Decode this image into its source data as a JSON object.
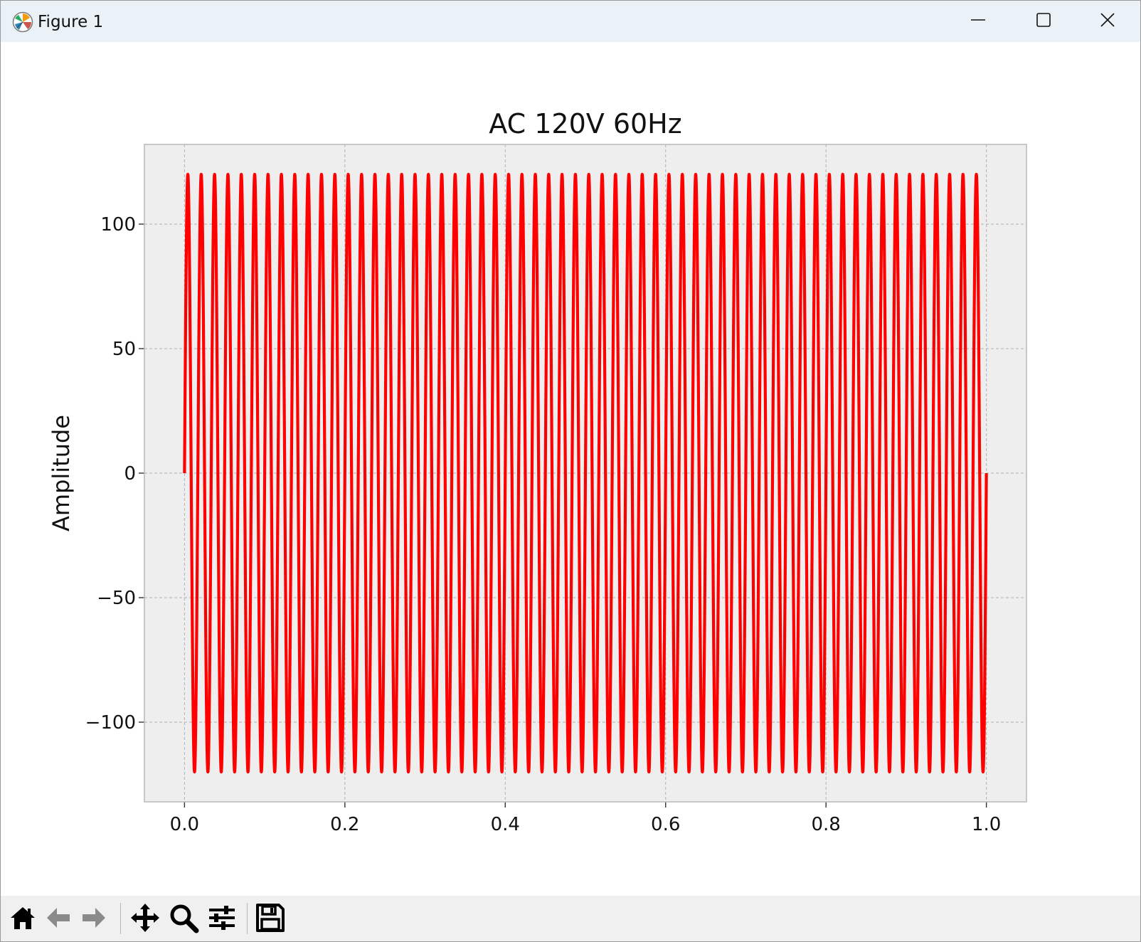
{
  "window": {
    "title": "Figure 1",
    "app_icon": "matplotlib-icon"
  },
  "window_controls": [
    {
      "name": "minimize-button",
      "icon": "minimize-icon"
    },
    {
      "name": "maximize-button",
      "icon": "maximize-icon"
    },
    {
      "name": "close-button",
      "icon": "close-icon"
    }
  ],
  "toolbar": {
    "tools": [
      {
        "name": "home-button",
        "icon": "home-icon"
      },
      {
        "name": "back-button",
        "icon": "arrow-left-icon"
      },
      {
        "name": "forward-button",
        "icon": "arrow-right-icon"
      },
      {
        "name": "pan-button",
        "icon": "move-icon"
      },
      {
        "name": "zoom-button",
        "icon": "magnifier-icon"
      },
      {
        "name": "configure-subplots-button",
        "icon": "sliders-icon"
      },
      {
        "name": "save-button",
        "icon": "floppy-disk-icon"
      }
    ]
  },
  "chart_data": {
    "type": "line",
    "title": "AC 120V 60Hz",
    "xlabel": "",
    "ylabel": "Amplitude",
    "xlim": [
      -0.05,
      1.05
    ],
    "ylim": [
      -132,
      132
    ],
    "xticks": [
      0.0,
      0.2,
      0.4,
      0.6,
      0.8,
      1.0
    ],
    "xtick_labels": [
      "0.0",
      "0.2",
      "0.4",
      "0.6",
      "0.8",
      "1.0"
    ],
    "yticks": [
      100,
      50,
      0,
      -50,
      -100
    ],
    "ytick_labels": [
      "100",
      "50",
      "0",
      "−50",
      "−100"
    ],
    "grid": true,
    "colors": {
      "line": "#ff0000",
      "axes_bg": "#eeeeee",
      "grid": "#b0b0b0"
    },
    "series": [
      {
        "function": "120*sin(2*pi*60*t)",
        "amplitude": 120,
        "frequency": 60,
        "x_start": 0.0,
        "x_end": 1.0,
        "color": "#ff0000"
      }
    ]
  }
}
